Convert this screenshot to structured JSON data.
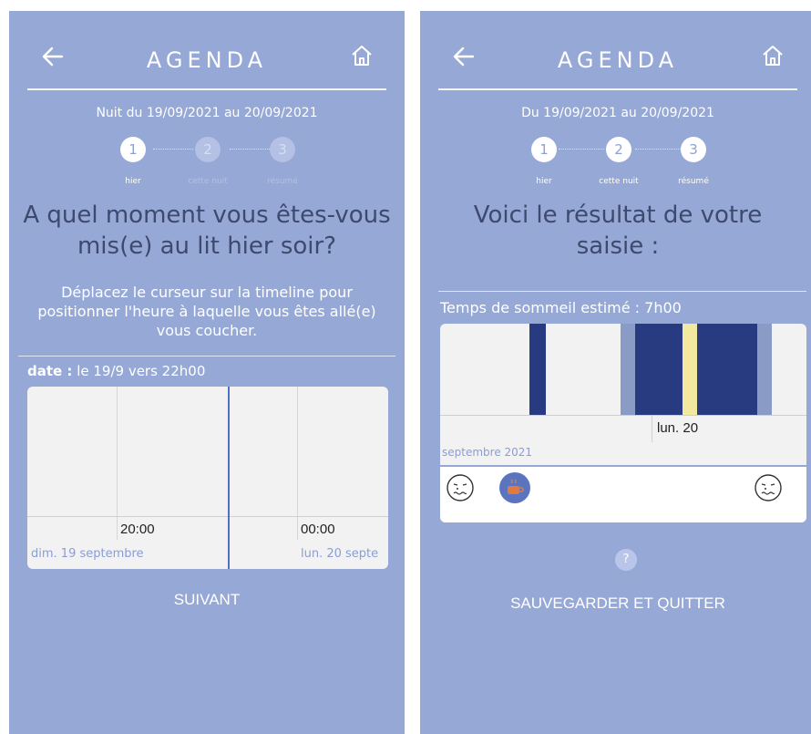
{
  "left": {
    "header_title": "AGENDA",
    "subtitle": "Nuit du 19/09/2021 au 20/09/2021",
    "steps": [
      {
        "num": "1",
        "label": "hier"
      },
      {
        "num": "2",
        "label": "cette nuit"
      },
      {
        "num": "3",
        "label": "résumé"
      }
    ],
    "question": "A quel moment vous êtes-vous mis(e) au lit hier soir?",
    "instruction": "Déplacez le curseur sur la timeline pour positionner l'heure à laquelle vous êtes allé(e) vous coucher.",
    "date_label": "date :",
    "date_value": " le 19/9 vers 22h00",
    "timeline": {
      "time_labels": [
        "20:00",
        "00:00"
      ],
      "date_labels": [
        "dim. 19 septembre",
        "lun. 20 septe"
      ]
    },
    "next_button": "SUIVANT"
  },
  "right": {
    "header_title": "AGENDA",
    "subtitle": "Du 19/09/2021 au 20/09/2021",
    "steps": [
      {
        "num": "1",
        "label": "hier"
      },
      {
        "num": "2",
        "label": "cette nuit"
      },
      {
        "num": "3",
        "label": "résumé"
      }
    ],
    "result_title": "Voici le résultat de votre saisie :",
    "sleep_estimate": "Temps de sommeil estimé : 7h00",
    "chart": {
      "day_label": "lun. 20",
      "month_label": "septembre 2021"
    },
    "help_button": "?",
    "save_quit_button": "SAUVEGARDER ET QUITTER"
  },
  "colors": {
    "background": "#96a8d6",
    "sleep_dark": "#283a80",
    "sleep_light": "#8a9cc6",
    "awake_yellow": "#f2e8a0",
    "coffee_orange": "#e07a40",
    "question_text": "#3d4a6e"
  }
}
